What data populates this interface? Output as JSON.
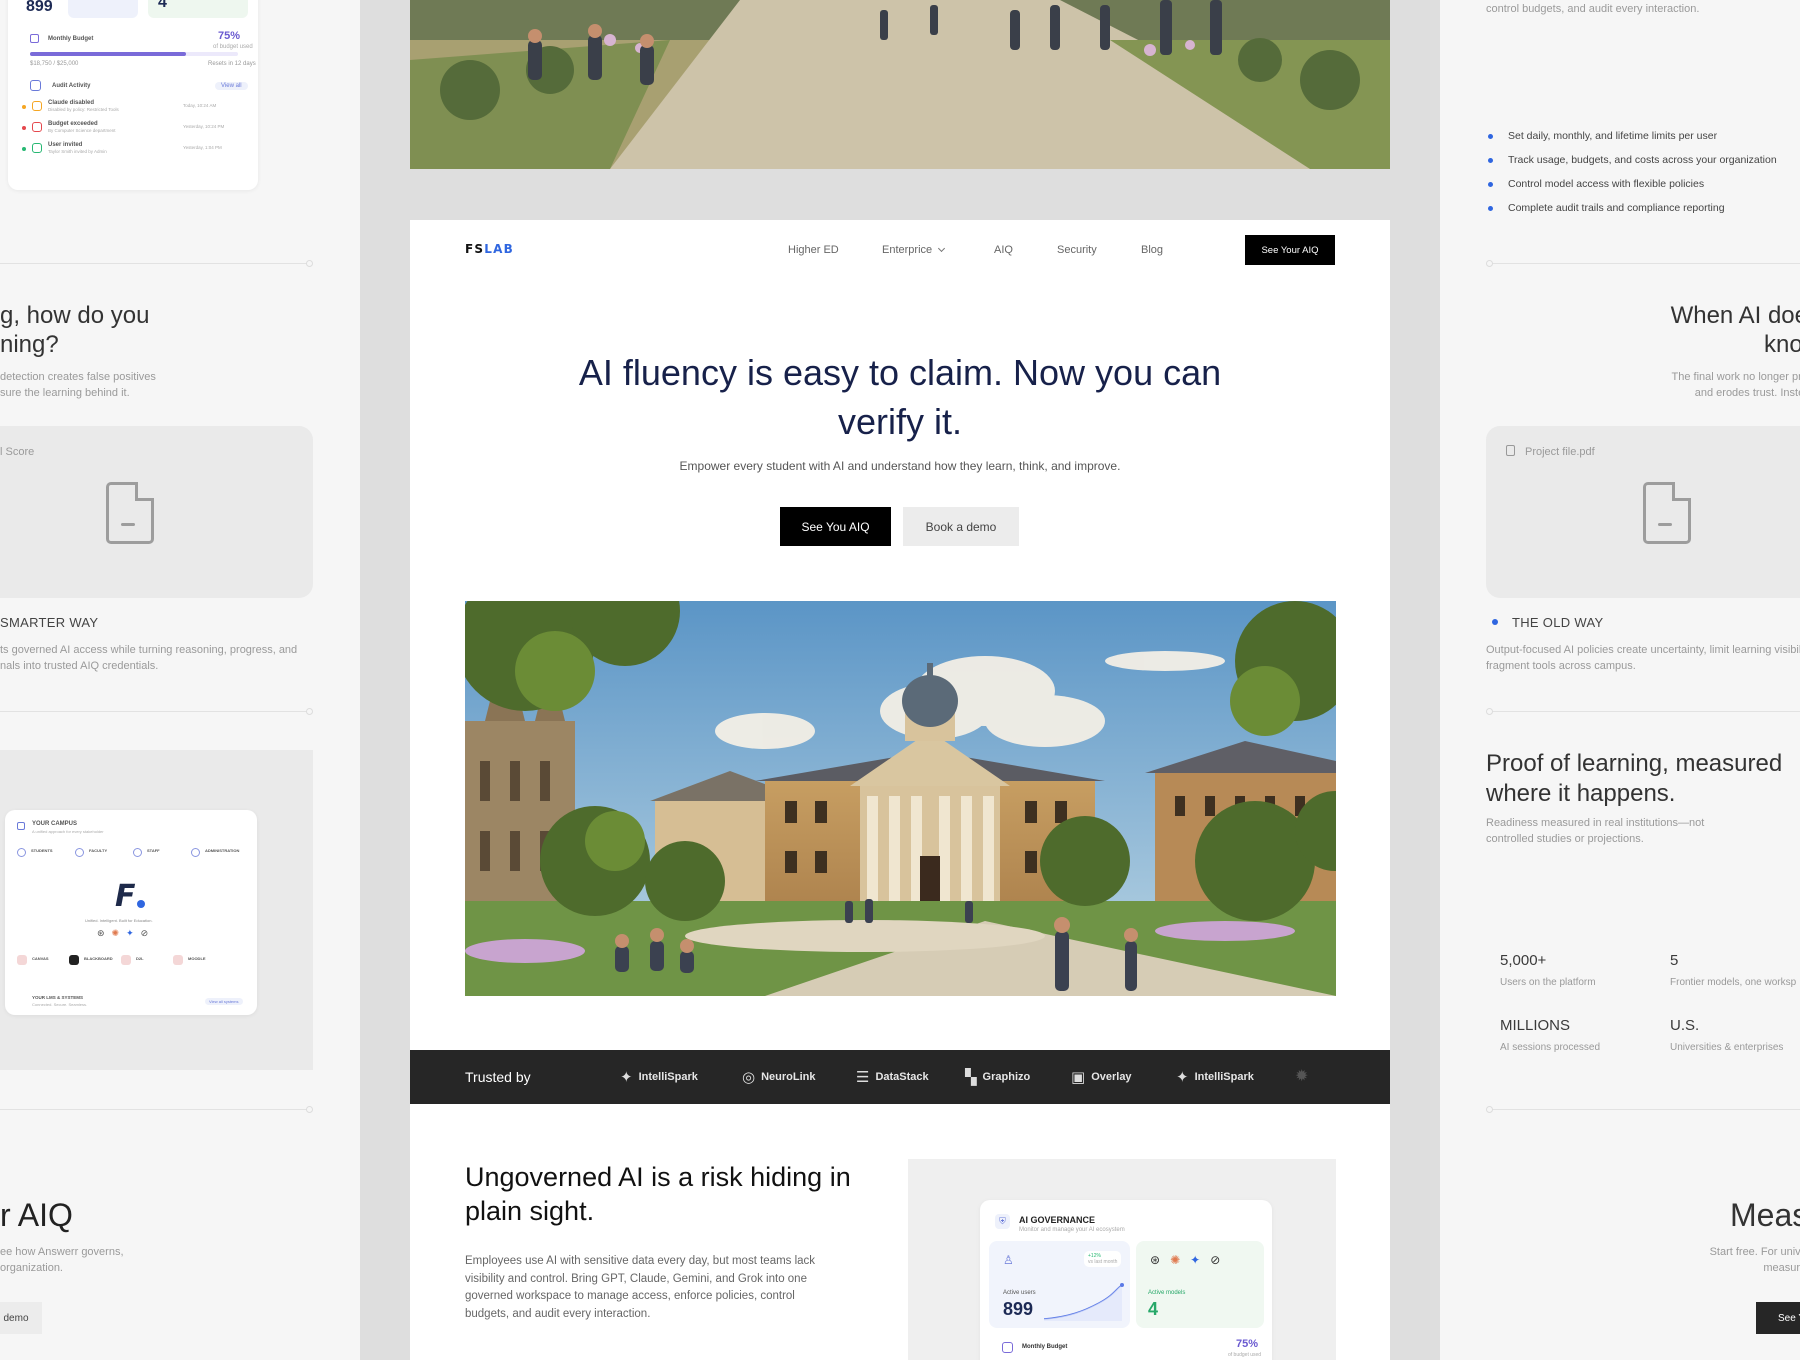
{
  "left_panel": {
    "dashboard": {
      "users_num": "899",
      "models_num": "4",
      "budget_title": "Monthly Budget",
      "budget_percent": "75%",
      "budget_percent_sub": "of budget used",
      "budget_amount": "$18,750 / $25,000",
      "budget_reset": "Resets in 12 days",
      "budget_fill": 0.75,
      "audit_title": "Audit Activity",
      "audit_view_all": "View all",
      "audit_items": [
        {
          "title": "Claude disabled",
          "sub": "Disabled by policy: Restricted Tools",
          "time": "Today, 10:24 AM",
          "color": "#f5a623"
        },
        {
          "title": "Budget exceeded",
          "sub": "By Computer Science department",
          "time": "Yesterday, 10:24 PM",
          "color": "#e5484d"
        },
        {
          "title": "User invited",
          "sub": "Taylor Smith invited by Admin",
          "time": "Yesterday, 1:04 PM",
          "color": "#27b873"
        }
      ]
    },
    "heading_fragment": "g, how do you\nning?",
    "small_text": "detection creates false positives\nsure the learning behind it.",
    "card_label": "l Score",
    "way_label": "SMARTER WAY",
    "way_text": "ts governed AI access while turning reasoning, progress, and\nnals into trusted AIQ credentials.",
    "campus": {
      "title": "YOUR CAMPUS",
      "subtitle": "A unified approach for every stakeholder",
      "roles": [
        "STUDENTS",
        "FACULTY",
        "STAFF",
        "ADMINISTRATION"
      ],
      "tagline": "Unified. Intelligent. Built for Education.",
      "integrations": [
        "CANVAS",
        "BLACKBOARD",
        "D2L",
        "MOODLE"
      ],
      "footer": "YOUR LMS & SYSTEMS",
      "footer_sub": "Connected. Secure. Seamless.",
      "footer_link": "View all systems"
    },
    "bottom_heading": "r AIQ",
    "bottom_text": "ee how Answerr governs,\norganization.",
    "bottom_button": "demo"
  },
  "center": {
    "nav": {
      "logo_a": "FS",
      "logo_b": "LAB",
      "items": [
        "Higher ED",
        "Enterprice",
        "AIQ",
        "Security",
        "Blog"
      ],
      "cta": "See Your AIQ"
    },
    "hero": {
      "title": "AI fluency is easy to claim. Now you can verify it.",
      "subtitle": "Empower every student with AI and understand how they learn, think, and improve.",
      "primary_button": "See You AIQ",
      "secondary_button": "Book a demo"
    },
    "trusted": {
      "label": "Trusted by",
      "logos": [
        {
          "name": "IntelliSpark",
          "icon": "spark-icon",
          "glyph": "✦"
        },
        {
          "name": "NeuroLink",
          "icon": "swirl-icon",
          "glyph": "◎"
        },
        {
          "name": "DataStack",
          "icon": "stack-icon",
          "glyph": "☰"
        },
        {
          "name": "Graphizo",
          "icon": "graph-icon",
          "glyph": "▚"
        },
        {
          "name": "Overlay",
          "icon": "overlay-icon",
          "glyph": "▣"
        },
        {
          "name": "IntelliSpark",
          "icon": "spark-icon",
          "glyph": "✦"
        }
      ]
    },
    "section": {
      "title": "Ungoverned AI is a risk hiding in plain sight.",
      "body": "Employees use AI with sensitive data every day, but most teams lack visibility and control. Bring GPT, Claude, Gemini, and Grok into one governed workspace to manage access, enforce policies, control budgets, and audit every interaction."
    },
    "governance": {
      "title": "AI GOVERNANCE",
      "subtitle": "Monitor and manage your AI ecosystem",
      "users_label": "Active users",
      "users_value": "899",
      "users_trend": "+12%",
      "users_trend_sub": "vs last month",
      "models_label": "Active models",
      "models_value": "4",
      "budget_label": "Monthly Budget",
      "budget_percent": "75%",
      "budget_sub": "of budget used"
    }
  },
  "right_panel": {
    "top_text": "control budgets, and audit every interaction.",
    "bullets": [
      "Set daily, monthly, and lifetime limits per user",
      "Track usage, budgets, and costs across your organization",
      "Control model access with flexible policies",
      "Complete audit trails and compliance reporting"
    ],
    "heading_fragment": "When AI does\nknow",
    "small_text": "The final work no longer proves\nand erodes trust. Instead c",
    "card_label": "Project file.pdf",
    "way_label": "THE OLD WAY",
    "way_text": "Output-focused AI policies create uncertainty, limit learning visibility,\nfragment tools across campus.",
    "proof_title": "Proof of learning, measured where it happens.",
    "proof_text": "Readiness measured in real institutions—not controlled studies or projections.",
    "stats": [
      {
        "value": "5,000+",
        "label": "Users on the platform"
      },
      {
        "value": "5",
        "label": "Frontier models, one worksp"
      },
      {
        "value": "MILLIONS",
        "label": "AI sessions processed"
      },
      {
        "value": "U.S.",
        "label": "Universities & enterprises"
      }
    ],
    "bottom_heading": "Meas",
    "bottom_text": "Start free. For universitie\nmeasures, an",
    "bottom_button": "See Y"
  }
}
